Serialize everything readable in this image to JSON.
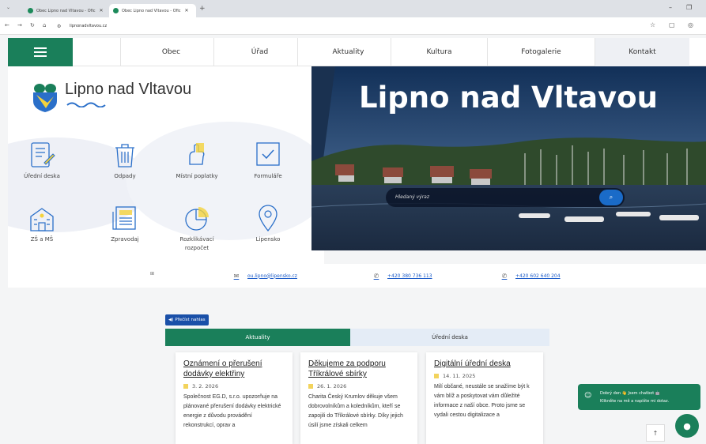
{
  "browser": {
    "tabs": [
      {
        "title": "Obec Lipno nad Vltavou - Ofic",
        "active": false
      },
      {
        "title": "Obec Lipno nad Vltavou - Ofic",
        "active": true
      }
    ],
    "url": "lipnonadvltavou.cz"
  },
  "nav": {
    "items": [
      "Obec",
      "Úřad",
      "Aktuality",
      "Kultura",
      "Fotogalerie",
      "Kontakt"
    ]
  },
  "logo": {
    "text": "Lipno nad Vltavou"
  },
  "tiles": [
    "Úřední deska",
    "Odpady",
    "Místní poplatky",
    "Formuláře",
    "ZŠ a MŠ",
    "Zpravodaj",
    "Rozklikávací rozpočet",
    "Lipensko"
  ],
  "hero": {
    "title": "Lipno nad Vltavou",
    "search_placeholder": "Hledaný výraz"
  },
  "contact": {
    "email": "ou.lipno@lipensko.cz",
    "phone1": "+420 380 736 113",
    "phone2": "+420 602 640 204"
  },
  "main": {
    "read_label": "Přečíst nahlas",
    "tabs": [
      "Aktuality",
      "Úřední deska"
    ],
    "cards": [
      {
        "title": "Oznámení o přerušení dodávky elektřiny",
        "date": "3. 2. 2026",
        "text": "Společnost EG.D, s.r.o. upozorňuje na plánované přerušení dodávky elektrické energie z důvodu provádění rekonstrukcí, oprav a"
      },
      {
        "title": "Děkujeme za podporu Tříkrálové sbírky",
        "date": "26. 1. 2026",
        "text": "Charita Český Krumlov děkuje všem dobrovolníkům a koledníkům, kteří se zapojili do Tříkrálové sbírky. Díky jejich úsilí jsme získali celkem"
      },
      {
        "title": "Digitální úřední deska",
        "date": "14. 11. 2025",
        "text": "Milí občané, neustále se snažíme být k vám blíž a poskytovat vám důležité informace z naší obce. Proto jsme se vydali cestou digitalizace a"
      }
    ]
  },
  "chat": {
    "line1": "Dobrý den 👋 Jsem chatbot 🤖",
    "line2": "Klikněte na mě a napište mi dotaz."
  },
  "colors": {
    "brand_green": "#1a7f5a",
    "link_blue": "#1a5ac8"
  }
}
